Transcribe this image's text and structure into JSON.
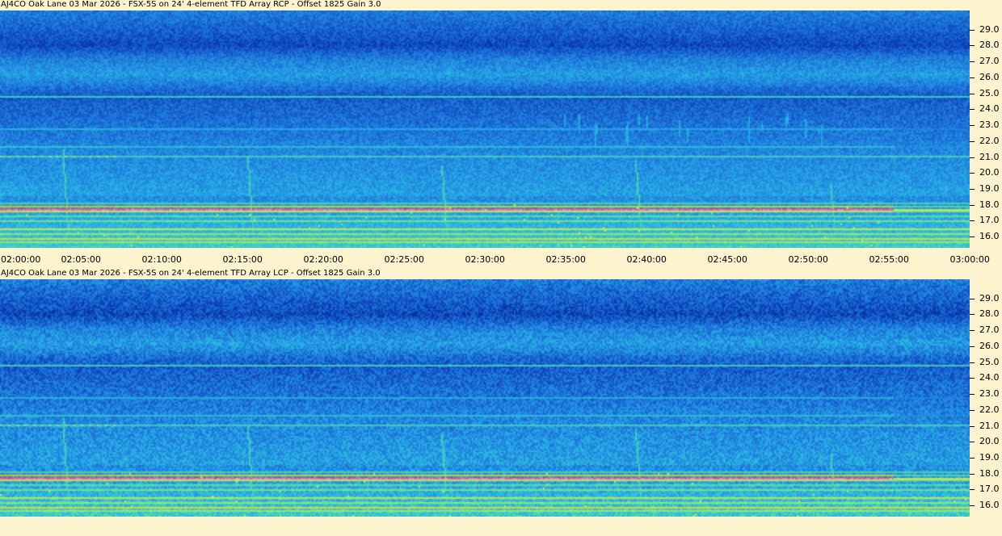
{
  "chart_data": [
    {
      "type": "heatmap",
      "title": "AJ4CO Oak Lane 03 Mar 2026 - FSX-5S on 24' 4-element TFD Array RCP  -  Offset 1825  Gain 3.0",
      "x_ticks": [
        "02:00:00",
        "02:05:00",
        "02:10:00",
        "02:15:00",
        "02:20:00",
        "02:25:00",
        "02:30:00",
        "02:35:00",
        "02:40:00",
        "02:45:00",
        "02:50:00",
        "02:55:00",
        "03:00:00"
      ],
      "y_ticks": [
        "29.0",
        "28.0",
        "27.0",
        "26.0",
        "25.0",
        "24.0",
        "23.0",
        "22.0",
        "21.0",
        "20.0",
        "19.0",
        "18.0",
        "17.0",
        "16.0"
      ],
      "x_range": [
        "02:00:00",
        "03:00:00"
      ],
      "y_range": [
        15.3,
        30.2
      ],
      "colormap": [
        "#00105a",
        "#0a3cb4",
        "#1e78dc",
        "#28b4e6",
        "#50dcaa",
        "#c8f050",
        "#ffb400",
        "#ff3c96",
        "#ffffff"
      ]
    },
    {
      "type": "heatmap",
      "title": "AJ4CO Oak Lane 03 Mar 2026 - FSX-5S on 24' 4-element TFD Array LCP  -  Offset 1825  Gain 3.0",
      "y_ticks": [
        "29.0",
        "28.0",
        "27.0",
        "26.0",
        "25.0",
        "24.0",
        "23.0",
        "22.0",
        "21.0",
        "20.0",
        "19.0",
        "18.0",
        "17.0",
        "16.0"
      ],
      "x_range": [
        "02:00:00",
        "03:00:00"
      ],
      "y_range": [
        15.3,
        30.2
      ],
      "colormap": [
        "#00105a",
        "#0a3cb4",
        "#1e78dc",
        "#28b4e6",
        "#50dcaa",
        "#c8f050",
        "#ffb400",
        "#ff3c96",
        "#ffffff"
      ]
    }
  ]
}
